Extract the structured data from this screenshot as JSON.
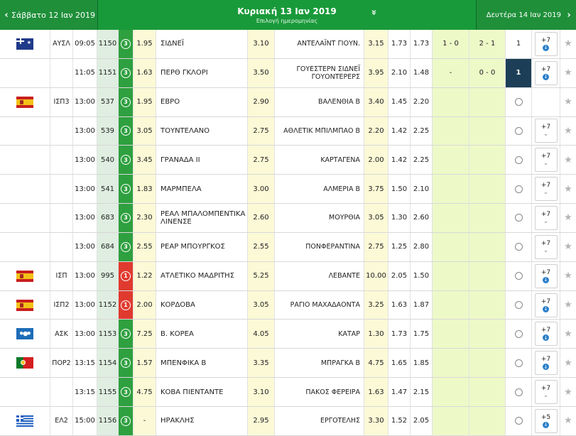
{
  "header": {
    "prev_day": "Σάββατο 12 Ιαν 2019",
    "current_day": "Κυριακή 13 Ιαν 2019",
    "date_pick": "Επιλογή ημερομηνίας",
    "next_day": "Δευτέρα 14 Ιαν 2019",
    "prev_arrow": "‹",
    "next_arrow": "›",
    "dropdown_icon": "»"
  },
  "rows": [
    {
      "flag": "au",
      "league": "ΑΥΣΛ",
      "time": "09:05",
      "code": "1150",
      "badge": "3",
      "badge_color": "green",
      "o1": "1.95",
      "home": "ΣΙΔΝΕΪ",
      "ox": "3.10",
      "away": "ΑΝΤΕΛΑΪΝΤ ΓΙΟΥΝ.",
      "o2": "3.15",
      "u": "1.73",
      "o": "1.73",
      "ht": "1 - 0",
      "ft": "2 - 1",
      "ft_marker": true,
      "live": "1",
      "live_style": "plain",
      "more": "+7",
      "more_icon": "down"
    },
    {
      "flag": "",
      "league": "",
      "time": "11:05",
      "code": "1151",
      "badge": "3",
      "badge_color": "green",
      "o1": "1.63",
      "home": "ΠΕΡΘ ΓΚΛΟΡΙ",
      "ox": "3.50",
      "away": "ΓΟΥΕΣΤΕΡΝ ΣΙΔΝΕΪ ΓΟΥΟΝΤΕΡΕΡΣ",
      "o2": "3.95",
      "u": "2.10",
      "o": "1.48",
      "ht": "-",
      "ft": "0 - 0",
      "ft_marker": false,
      "live": "1",
      "live_style": "dark",
      "more": "+7",
      "more_icon": "down"
    },
    {
      "flag": "es",
      "league": "ΙΣΠ3",
      "time": "13:00",
      "code": "537",
      "badge": "3",
      "badge_color": "green",
      "o1": "1.95",
      "home": "ΕΒΡΟ",
      "ox": "2.90",
      "away": "ΒΑΛΕΝΘΙΑ Β",
      "o2": "3.40",
      "u": "1.45",
      "o": "2.20",
      "ht": "",
      "ft": "",
      "ft_marker": false,
      "live": "",
      "live_style": "clock",
      "more": "",
      "more_icon": "none"
    },
    {
      "flag": "",
      "league": "",
      "time": "13:00",
      "code": "539",
      "badge": "3",
      "badge_color": "green",
      "o1": "3.05",
      "home": "ΤΟΥΝΤΕΛΑΝΟ",
      "ox": "2.75",
      "away": "ΑΘΛΕΤΙΚ ΜΠΙΛΜΠΑΟ Β",
      "o2": "2.20",
      "u": "1.42",
      "o": "2.25",
      "ht": "",
      "ft": "",
      "ft_marker": false,
      "live": "",
      "live_style": "clock",
      "more": "+7",
      "more_icon": "chevron"
    },
    {
      "flag": "",
      "league": "",
      "time": "13:00",
      "code": "540",
      "badge": "3",
      "badge_color": "green",
      "o1": "3.45",
      "home": "ΓΡΑΝΑΔΑ ΙΙ",
      "ox": "2.75",
      "away": "ΚΑΡΤΑΓΕΝΑ",
      "o2": "2.00",
      "u": "1.42",
      "o": "2.25",
      "ht": "",
      "ft": "",
      "ft_marker": false,
      "live": "",
      "live_style": "clock",
      "more": "+7",
      "more_icon": "chevron"
    },
    {
      "flag": "",
      "league": "",
      "time": "13:00",
      "code": "541",
      "badge": "3",
      "badge_color": "green",
      "o1": "1.83",
      "home": "ΜΑΡΜΠΕΛΑ",
      "ox": "3.00",
      "away": "ΑΛΜΕΡΙΑ Β",
      "o2": "3.75",
      "u": "1.50",
      "o": "2.10",
      "ht": "",
      "ft": "",
      "ft_marker": false,
      "live": "",
      "live_style": "clock",
      "more": "+7",
      "more_icon": "chevron"
    },
    {
      "flag": "",
      "league": "",
      "time": "13:00",
      "code": "683",
      "badge": "3",
      "badge_color": "green",
      "o1": "2.30",
      "home": "ΡΕΑΛ ΜΠΑΛΟΜΠΕΝΤΙΚΑ ΛΙΝΕΝΣΕ",
      "ox": "2.60",
      "away": "ΜΟΥΡΘΙΑ",
      "o2": "3.05",
      "u": "1.30",
      "o": "2.60",
      "ht": "",
      "ft": "",
      "ft_marker": false,
      "live": "",
      "live_style": "clock",
      "more": "+7",
      "more_icon": "chevron"
    },
    {
      "flag": "",
      "league": "",
      "time": "13:00",
      "code": "684",
      "badge": "3",
      "badge_color": "green",
      "o1": "2.55",
      "home": "ΡΕΑΡ ΜΠΟΥΡΓΚΟΣ",
      "ox": "2.55",
      "away": "ΠΟΝΦΕΡΑΝΤΙΝΑ",
      "o2": "2.75",
      "u": "1.25",
      "o": "2.80",
      "ht": "",
      "ft": "",
      "ft_marker": false,
      "live": "",
      "live_style": "clock",
      "more": "+7",
      "more_icon": "chevron"
    },
    {
      "flag": "es",
      "league": "ΙΣΠ",
      "time": "13:00",
      "code": "995",
      "badge": "1",
      "badge_color": "red",
      "o1": "1.22",
      "home": "ΑΤΛΕΤΙΚΟ ΜΑΔΡΙΤΗΣ",
      "ox": "5.25",
      "away": "ΛΕΒΑΝΤΕ",
      "o2": "10.00",
      "u": "2.05",
      "o": "1.50",
      "ht": "",
      "ft": "",
      "ft_marker": false,
      "live": "",
      "live_style": "clock",
      "more": "+7",
      "more_icon": "down"
    },
    {
      "flag": "es",
      "league": "ΙΣΠ2",
      "time": "13:00",
      "code": "1152",
      "badge": "1",
      "badge_color": "red",
      "o1": "2.00",
      "home": "ΚΟΡΔΟΒΑ",
      "ox": "3.05",
      "away": "ΡΑΓΙΟ ΜΑΧΑΔΑΟΝΤΑ",
      "o2": "3.25",
      "u": "1.63",
      "o": "1.87",
      "ht": "",
      "ft": "",
      "ft_marker": false,
      "live": "",
      "live_style": "clock",
      "more": "+7",
      "more_icon": "down"
    },
    {
      "flag": "world",
      "league": "ΑΣΚ",
      "time": "13:00",
      "code": "1153",
      "badge": "3",
      "badge_color": "green",
      "o1": "7.25",
      "home": "Β. ΚΟΡΕΑ",
      "ox": "4.05",
      "away": "ΚΑΤΑΡ",
      "o2": "1.30",
      "u": "1.73",
      "o": "1.75",
      "ht": "",
      "ft": "",
      "ft_marker": false,
      "live": "",
      "live_style": "clock",
      "more": "+7",
      "more_icon": "down"
    },
    {
      "flag": "pt",
      "league": "ΠΟΡ2",
      "time": "13:15",
      "code": "1154",
      "badge": "3",
      "badge_color": "green",
      "o1": "1.57",
      "home": "ΜΠΕΝΦΙΚΑ Β",
      "ox": "3.35",
      "away": "ΜΠΡΑΓΚΑ Β",
      "o2": "4.75",
      "u": "1.65",
      "o": "1.85",
      "ht": "",
      "ft": "",
      "ft_marker": false,
      "live": "",
      "live_style": "clock",
      "more": "+7",
      "more_icon": "down"
    },
    {
      "flag": "",
      "league": "",
      "time": "13:15",
      "code": "1155",
      "badge": "3",
      "badge_color": "green",
      "o1": "4.75",
      "home": "ΚΟΒΑ ΠΙΕΝΤΑΝΤΕ",
      "ox": "3.10",
      "away": "ΠΑΚΟΣ ΦΕΡΕΙΡΑ",
      "o2": "1.63",
      "u": "1.47",
      "o": "2.15",
      "ht": "",
      "ft": "",
      "ft_marker": false,
      "live": "",
      "live_style": "clock",
      "more": "+7",
      "more_icon": "chevron"
    },
    {
      "flag": "gr",
      "league": "ΕΛ2",
      "time": "15:00",
      "code": "1156",
      "badge": "3",
      "badge_color": "green",
      "o1": "-",
      "home": "ΗΡΑΚΛΗΣ",
      "ox": "2.95",
      "away": "ΕΡΓΟΤΕΛΗΣ",
      "o2": "3.30",
      "u": "1.52",
      "o": "2.05",
      "ht": "",
      "ft": "",
      "ft_marker": false,
      "live": "",
      "live_style": "clock",
      "more": "+5",
      "more_icon": "down"
    }
  ],
  "colors": {
    "header_green": "#199a3a",
    "badge_green": "#2ea03f",
    "badge_red": "#e03a2f",
    "live_dark": "#1c3f57",
    "odds_bg": "#fbf9d6",
    "score_bg": "#eef9c8"
  }
}
